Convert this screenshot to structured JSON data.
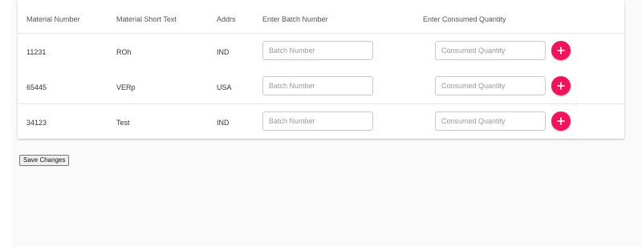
{
  "table": {
    "headers": {
      "material_number": "Material Number",
      "material_short_text": "Material Short Text",
      "addrs": "Addrs",
      "batch": "Enter Batch Number",
      "quantity": "Enter Consumed Quantity"
    },
    "rows": [
      {
        "material_number": "11231",
        "short_text": "ROh",
        "addrs": "IND",
        "batch_value": "",
        "batch_placeholder": "Batch Number",
        "qty_value": "",
        "qty_placeholder": "Consumed Quantity"
      },
      {
        "material_number": "65445",
        "short_text": "VERp",
        "addrs": "USA",
        "batch_value": "",
        "batch_placeholder": "Batch Number",
        "qty_value": "",
        "qty_placeholder": "Consumed Quantity"
      },
      {
        "material_number": "34123",
        "short_text": "Test",
        "addrs": "IND",
        "batch_value": "",
        "batch_placeholder": "Batch Number",
        "qty_value": "",
        "qty_placeholder": "Consumed Quantity"
      }
    ]
  },
  "actions": {
    "add_icon": "plus-icon",
    "save_label": "Save Changes"
  },
  "colors": {
    "accent": "#f0145a",
    "background": "#fafafa",
    "card": "#ffffff"
  }
}
